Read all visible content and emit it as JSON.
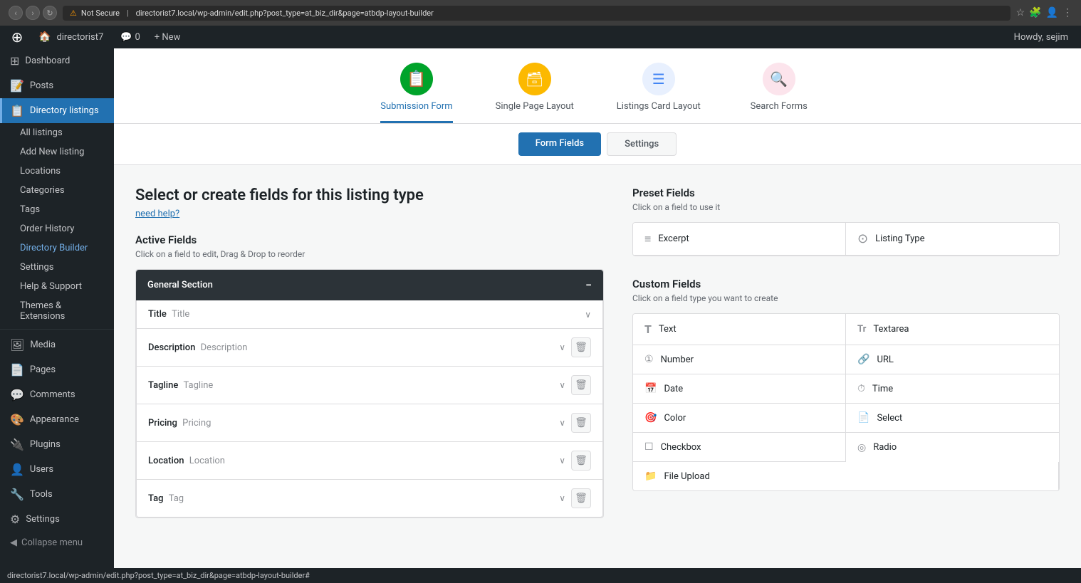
{
  "browser": {
    "url": "directorist7.local/wp-admin/edit.php?post_type=at_biz_dir&page=atbdp-layout-builder",
    "insecure_label": "Not Secure"
  },
  "wp_admin_bar": {
    "site_name": "directorist7",
    "comments_count": "0",
    "new_label": "+ New",
    "howdy": "Howdy, sejim"
  },
  "sidebar": {
    "items": [
      {
        "id": "dashboard",
        "label": "Dashboard",
        "icon": "⊞"
      },
      {
        "id": "posts",
        "label": "Posts",
        "icon": "📝"
      },
      {
        "id": "directory-listings",
        "label": "Directory listings",
        "icon": "📋",
        "active": true
      },
      {
        "id": "media",
        "label": "Media",
        "icon": "🖼"
      },
      {
        "id": "pages",
        "label": "Pages",
        "icon": "📄"
      },
      {
        "id": "comments",
        "label": "Comments",
        "icon": "💬"
      },
      {
        "id": "appearance",
        "label": "Appearance",
        "icon": "🎨"
      },
      {
        "id": "plugins",
        "label": "Plugins",
        "icon": "🔌"
      },
      {
        "id": "users",
        "label": "Users",
        "icon": "👤"
      },
      {
        "id": "tools",
        "label": "Tools",
        "icon": "🔧"
      },
      {
        "id": "settings",
        "label": "Settings",
        "icon": "⚙"
      }
    ],
    "directory_sub_items": [
      {
        "id": "all-listings",
        "label": "All listings"
      },
      {
        "id": "add-new-listing",
        "label": "Add New listing"
      },
      {
        "id": "locations",
        "label": "Locations"
      },
      {
        "id": "categories",
        "label": "Categories"
      },
      {
        "id": "tags",
        "label": "Tags"
      },
      {
        "id": "order-history",
        "label": "Order History"
      },
      {
        "id": "directory-builder",
        "label": "Directory Builder"
      },
      {
        "id": "dir-settings",
        "label": "Settings"
      },
      {
        "id": "help-support",
        "label": "Help & Support"
      },
      {
        "id": "themes-extensions",
        "label": "Themes & Extensions"
      }
    ],
    "collapse_label": "Collapse menu"
  },
  "top_nav": {
    "tabs": [
      {
        "id": "submission-form",
        "label": "Submission Form",
        "icon_char": "📋",
        "icon_class": "nav-icon-green",
        "active": true
      },
      {
        "id": "single-page-layout",
        "label": "Single Page Layout",
        "icon_char": "🗃",
        "icon_class": "nav-icon-orange",
        "active": false
      },
      {
        "id": "listings-card-layout",
        "label": "Listings Card Layout",
        "icon_char": "☰",
        "icon_class": "nav-icon-blue",
        "active": false
      },
      {
        "id": "search-forms",
        "label": "Search Forms",
        "icon_char": "🔍",
        "icon_class": "nav-icon-pink",
        "active": false
      }
    ]
  },
  "sub_tabs": {
    "tabs": [
      {
        "id": "form-fields",
        "label": "Form Fields",
        "active": true
      },
      {
        "id": "settings",
        "label": "Settings",
        "active": false
      }
    ]
  },
  "page": {
    "title": "Select or create fields for this listing type",
    "help_link": "need help?",
    "active_fields_label": "Active Fields",
    "active_fields_sub": "Click on a field to edit, Drag & Drop to reorder",
    "preset_fields_label": "Preset Fields",
    "preset_fields_sub": "Click on a field to use it",
    "custom_fields_label": "Custom Fields",
    "custom_fields_sub": "Click on a field type you want to create"
  },
  "general_section": {
    "label": "General Section",
    "fields": [
      {
        "id": "title",
        "name": "Title",
        "placeholder": "Title",
        "has_delete": false
      },
      {
        "id": "description",
        "name": "Description",
        "placeholder": "Description",
        "has_delete": true
      },
      {
        "id": "tagline",
        "name": "Tagline",
        "placeholder": "Tagline",
        "has_delete": true
      },
      {
        "id": "pricing",
        "name": "Pricing",
        "placeholder": "Pricing",
        "has_delete": true
      },
      {
        "id": "location",
        "name": "Location",
        "placeholder": "Location",
        "has_delete": true
      },
      {
        "id": "tag",
        "name": "Tag",
        "placeholder": "Tag",
        "has_delete": true
      }
    ]
  },
  "preset_fields": [
    {
      "id": "excerpt",
      "label": "Excerpt",
      "icon": "≡"
    },
    {
      "id": "listing-type",
      "label": "Listing Type",
      "icon": "⊙"
    }
  ],
  "custom_fields": [
    {
      "id": "text",
      "label": "Text",
      "icon": "T"
    },
    {
      "id": "textarea",
      "label": "Textarea",
      "icon": "Tr"
    },
    {
      "id": "number",
      "label": "Number",
      "icon": "⓪"
    },
    {
      "id": "url",
      "label": "URL",
      "icon": "🔗"
    },
    {
      "id": "date",
      "label": "Date",
      "icon": "📅"
    },
    {
      "id": "time",
      "label": "Time",
      "icon": "⏱"
    },
    {
      "id": "color",
      "label": "Color",
      "icon": "🎯"
    },
    {
      "id": "select",
      "label": "Select",
      "icon": "📄"
    },
    {
      "id": "checkbox",
      "label": "Checkbox",
      "icon": "☐"
    },
    {
      "id": "radio",
      "label": "Radio",
      "icon": "◎"
    },
    {
      "id": "file-upload",
      "label": "File Upload",
      "icon": "📁"
    }
  ],
  "status_bar": {
    "url": "directorist7.local/wp-admin/edit.php?post_type=at_biz_dir&page=atbdp-layout-builder#"
  }
}
